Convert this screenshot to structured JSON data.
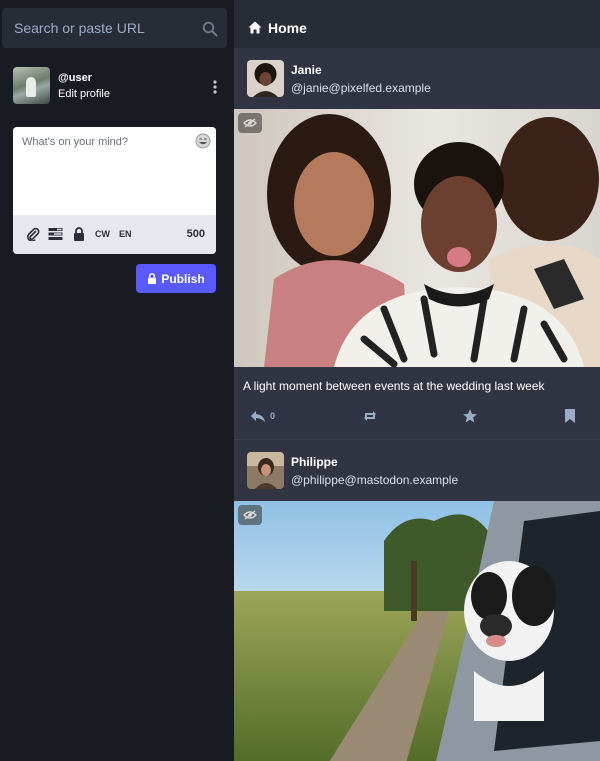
{
  "search": {
    "placeholder": "Search or paste URL",
    "icon": "search-icon"
  },
  "profile": {
    "handle": "@user",
    "edit_label": "Edit profile"
  },
  "compose": {
    "placeholder": "What's on your mind?",
    "tools": {
      "cw_label": "CW",
      "lang_label": "EN"
    },
    "char_count": "500",
    "publish_label": "Publish"
  },
  "column": {
    "title": "Home",
    "icon": "home-icon"
  },
  "statuses": [
    {
      "name": "Janie",
      "acct": "@janie@pixelfed.example",
      "caption": "A light moment between events at the wedding last week",
      "reply_count": "0"
    },
    {
      "name": "Philippe",
      "acct": "@philippe@mastodon.example"
    }
  ],
  "colors": {
    "background": "#191b22",
    "column": "#282c37",
    "status": "#313543",
    "accent": "#595aff",
    "icon_muted": "#9baec8"
  }
}
